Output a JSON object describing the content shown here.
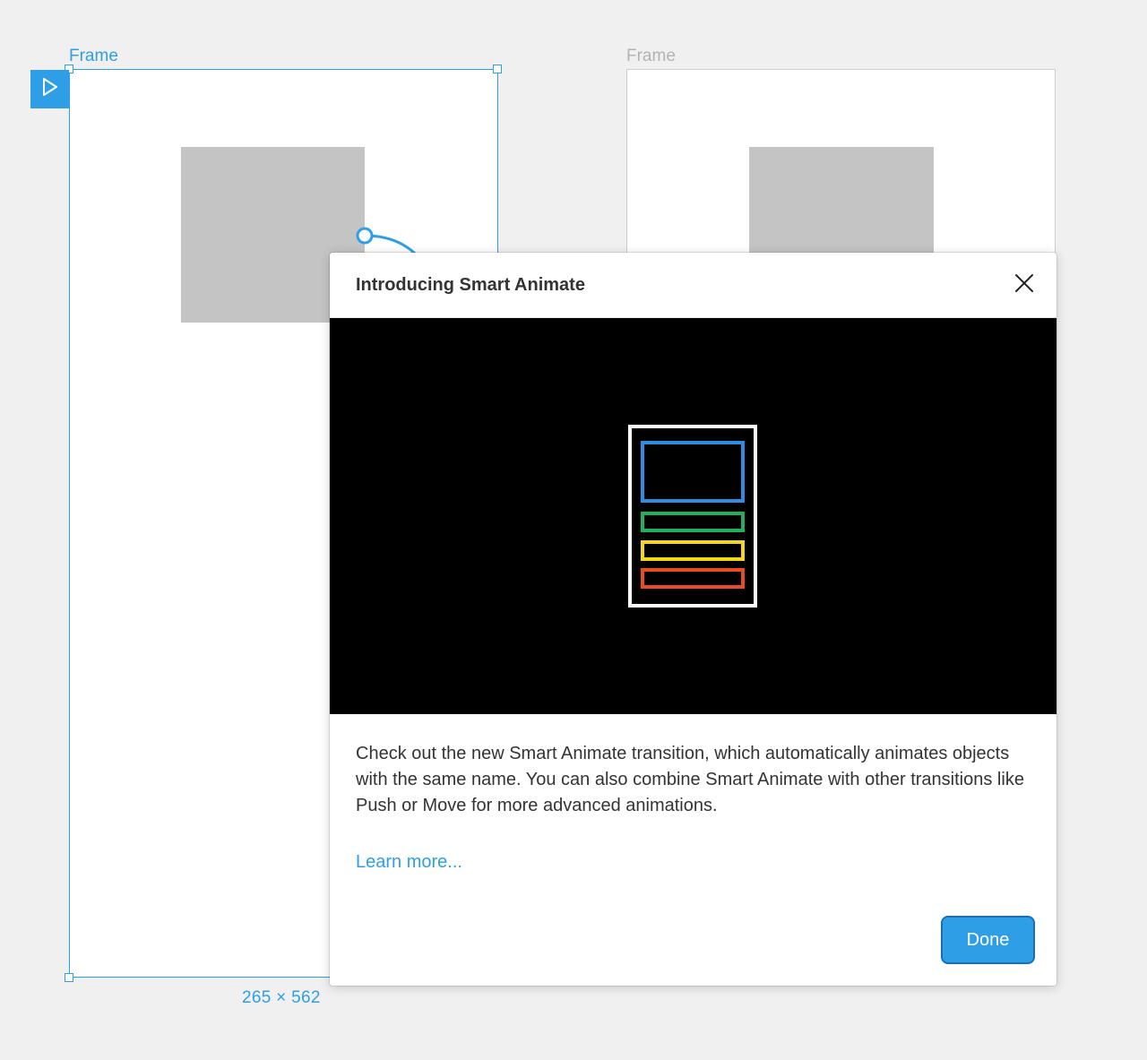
{
  "canvas": {
    "frames": [
      {
        "label": "Frame",
        "selected": true
      },
      {
        "label": "Frame",
        "selected": false
      }
    ],
    "size_label": "265 × 562"
  },
  "modal": {
    "title": "Introducing Smart Animate",
    "body": "Check out the new Smart Animate transition, which automatically animates objects with the same name. You can also combine Smart Animate with other transitions like Push or Move for more advanced animations.",
    "learn_more": "Learn more...",
    "done_label": "Done"
  },
  "icons": {
    "play": "play-icon",
    "close": "close-icon"
  },
  "colors": {
    "accent": "#2e9fe6",
    "illustration_blue": "#2d8de3",
    "illustration_green": "#20b05e",
    "illustration_yellow": "#f5d80f",
    "illustration_red": "#e94b24"
  }
}
